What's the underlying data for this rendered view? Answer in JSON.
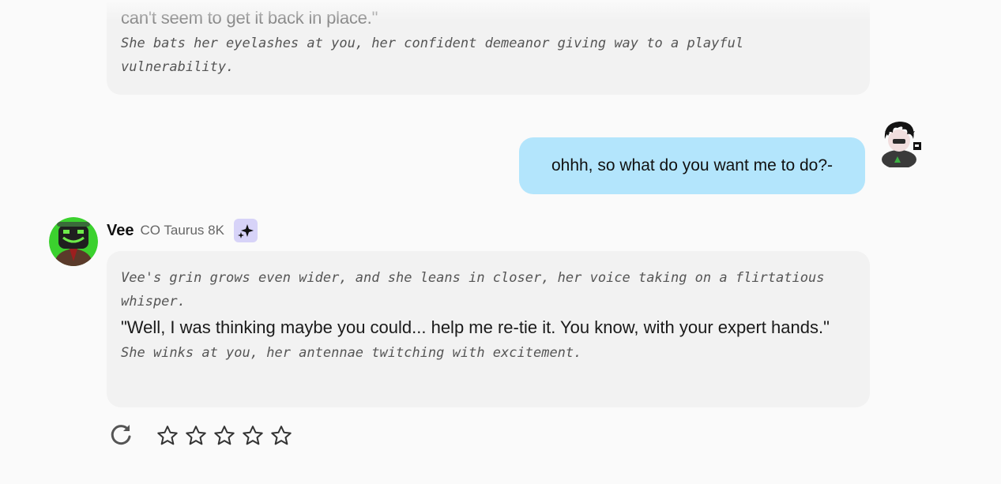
{
  "previous_message": {
    "faded_text": "can't seem to get it back in place.\"",
    "action_text": "She bats her eyelashes at you, her confident demeanor giving way to a playful vulnerability."
  },
  "user_message": {
    "text": "ohhh, so what do you want me to do?-",
    "avatar_icon": "user-avatar-icon",
    "bubble_color": "#b3e5fc"
  },
  "bot": {
    "name": "Vee",
    "meta": "CO Taurus 8K",
    "badge_icon": "sparkle-icon",
    "badge_color": "#d7d3f8",
    "avatar_icon": "bot-avatar-icon"
  },
  "bot_message": {
    "action_1": "Vee's grin grows even wider, and she leans in closer, her voice taking on a flirtatious whisper.",
    "speech": "\"Well, I was thinking maybe you could... help me re-tie it. You know, with your expert hands.\"",
    "action_2": "She winks at you, her antennae twitching with excitement."
  },
  "controls": {
    "regenerate_icon": "refresh-icon",
    "rating": {
      "value": 0,
      "max": 5,
      "icon": "star-outline-icon"
    }
  }
}
